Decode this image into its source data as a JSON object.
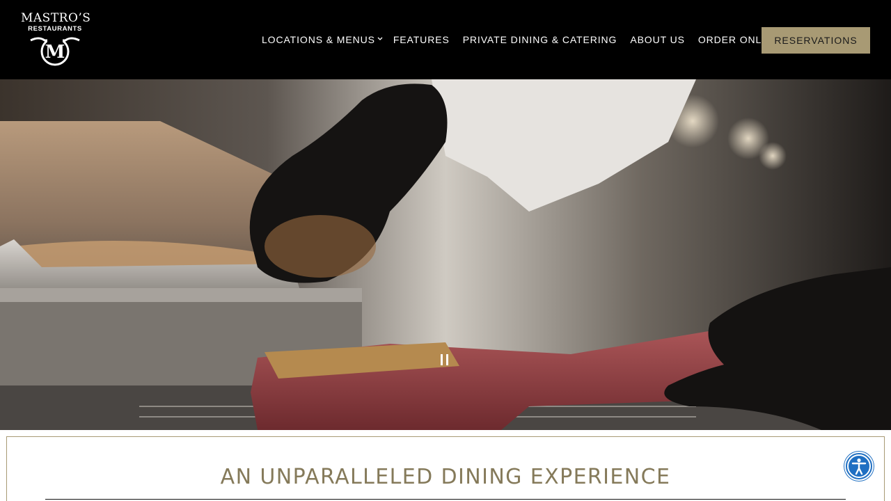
{
  "brand": {
    "name_line1": "MASTRO’S",
    "name_line2": "RESTAURANTS",
    "mark": "M"
  },
  "nav": {
    "items": [
      {
        "label": "LOCATIONS & MENUS",
        "has_dropdown": true
      },
      {
        "label": "FEATURES"
      },
      {
        "label": "PRIVATE DINING & CATERING"
      },
      {
        "label": "ABOUT US"
      },
      {
        "label": "ORDER ONLINE"
      }
    ],
    "reservations_label": "RESERVATIONS"
  },
  "hero": {
    "video_control_icon": "pause-icon"
  },
  "section": {
    "headline": "AN UNPARALLELED DINING EXPERIENCE"
  },
  "accessibility": {
    "icon": "accessibility-icon"
  },
  "colors": {
    "header_bg": "#000000",
    "accent_gold": "#a89a74",
    "headline_color": "#857a5a",
    "a11y_blue": "#1f6fc2"
  }
}
